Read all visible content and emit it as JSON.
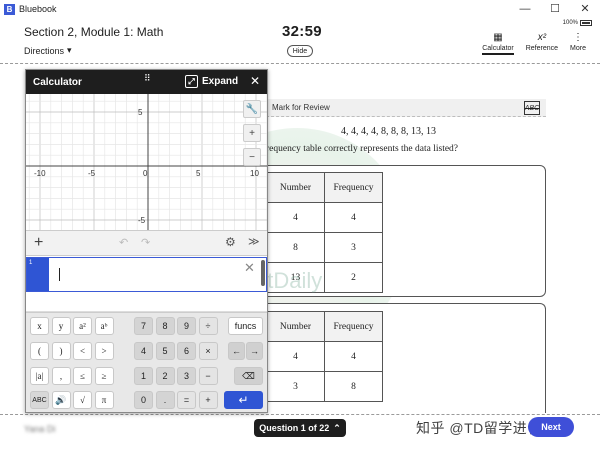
{
  "app": {
    "name": "Bluebook",
    "logo": "B"
  },
  "window_controls": {
    "minimize": "—",
    "maximize": "☐",
    "close": "✕"
  },
  "header": {
    "section_title": "Section 2, Module 1: Math",
    "directions_label": "Directions",
    "timer": "32:59",
    "hide_label": "Hide",
    "battery": "100%",
    "tools": [
      {
        "label": "Calculator",
        "icon": "calculator-icon"
      },
      {
        "label": "Reference",
        "icon": "reference-icon"
      },
      {
        "label": "More",
        "icon": "more-icon"
      }
    ]
  },
  "question": {
    "mark_for_review": "Mark for Review",
    "abc_label": "ABC",
    "data_list": "4, 4, 4, 4, 8, 8, 8, 13, 13",
    "stem_visible": "requency table correctly represents the data listed?",
    "choice_a": {
      "headers": [
        "Number",
        "Frequency"
      ],
      "rows": [
        [
          "4",
          "4"
        ],
        [
          "8",
          "3"
        ],
        [
          "13",
          "2"
        ]
      ]
    },
    "choice_b": {
      "headers": [
        "Number",
        "Frequency"
      ],
      "rows": [
        [
          "4",
          "4"
        ],
        [
          "3",
          "8"
        ]
      ]
    }
  },
  "calculator": {
    "title": "Calculator",
    "expand_label": "Expand",
    "close_label": "✕",
    "grip": "⠿",
    "side_tools": [
      "🔧",
      "+",
      "−"
    ],
    "expression_index": "1",
    "x_ticks": [
      "-10",
      "-5",
      "0",
      "5",
      "10"
    ],
    "y_ticks": [
      "5",
      "-5"
    ],
    "keys": {
      "row1": [
        "x",
        "y",
        "a²",
        "aᵇ",
        "7",
        "8",
        "9",
        "÷",
        "funcs"
      ],
      "row2": [
        "(",
        ")",
        "<",
        ">",
        "4",
        "5",
        "6",
        "×",
        "←",
        "→"
      ],
      "row3": [
        "|a|",
        ",",
        "≤",
        "≥",
        "1",
        "2",
        "3",
        "−",
        "⌫"
      ],
      "row4": [
        "ABC",
        "🔊",
        "√",
        "π",
        "0",
        ".",
        "=",
        "+",
        "↵"
      ]
    }
  },
  "footer": {
    "student_name": "Yana Di",
    "question_nav": "Question 1 of 22",
    "next_label": "Next",
    "watermark_text": "知乎 @TD留学进化论"
  },
  "watermark": {
    "text": "TestDaily"
  }
}
